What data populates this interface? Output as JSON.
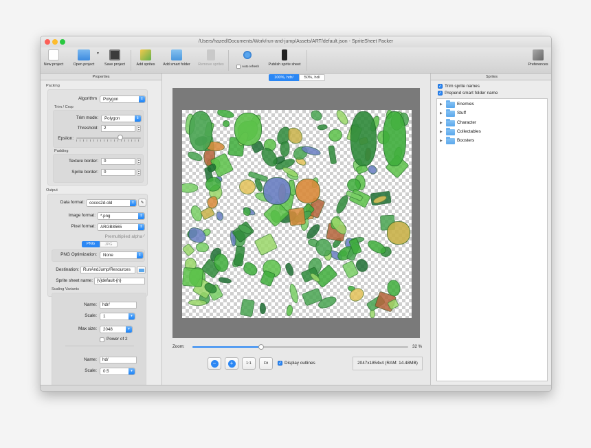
{
  "window": {
    "title": "/Users/hazed/Documents/Work/run-and-jump/Assets/ART/default.json - SpriteSheet Packer"
  },
  "toolbar": {
    "new_project": "New project",
    "open_project": "Open project",
    "save_project": "Save project",
    "add_sprites": "Add sprites",
    "add_smart_folder": "Add smart folder",
    "remove_sprites": "Remove sprites",
    "auto_refresh": "Auto refresh",
    "publish": "Publish sprite sheet",
    "preferences": "Preferences"
  },
  "properties": {
    "header": "Properties",
    "packing": {
      "title": "Packing",
      "algorithm_label": "Algorithm",
      "algorithm_value": "Polygon",
      "trim_title": "Trim / Crop",
      "trim_mode_label": "Trim mode:",
      "trim_mode_value": "Polygon",
      "threshold_label": "Threshold:",
      "threshold_value": "2",
      "epsilon_label": "Epsilon:",
      "epsilon_level": 0.68,
      "padding_title": "Padding",
      "texture_border_label": "Texture border:",
      "texture_border_value": "0",
      "sprite_border_label": "Sprite border:",
      "sprite_border_value": "0"
    },
    "output": {
      "title": "Output",
      "data_format_label": "Data format:",
      "data_format_value": "cocos2d-old",
      "image_format_label": "Image format:",
      "image_format_value": "*.png",
      "pixel_format_label": "Pixel format:",
      "pixel_format_value": "ARGB8565",
      "premultiplied": "Premultiplied alpha",
      "seg_png": "PNG",
      "seg_jpg": "JPG",
      "png_opt_label": "PNG Optimization:",
      "png_opt_value": "None",
      "destination_label": "Destination:",
      "destination_value": "RunAndJump/Resources",
      "sheet_name_label": "Sprite sheet name:",
      "sheet_name_value": "{v}default-{n}"
    },
    "scaling": {
      "title": "Scaling Variants",
      "name_label": "Name:",
      "name_value": "hdr/",
      "scale_label": "Scale:",
      "scale_value": "1",
      "max_size_label": "Max size:",
      "max_size_value": "2048",
      "power_of_2": "Power of 2",
      "name2_value": "hd/",
      "scale2_value": "0.5"
    }
  },
  "center": {
    "tabs": [
      "100%, hdr/",
      "50%, hd/"
    ],
    "zoom_label": "Zoom:",
    "zoom_value": "32 %",
    "zoom_level": 0.32,
    "btn_1to1": "1:1",
    "btn_fit": "Fit",
    "display_outlines": "Display outlines",
    "info": "2047x1854x4 (RAM: 14.48MB)"
  },
  "sprites": {
    "header": "Sprites",
    "trim_names": "Trim sprite names",
    "prepend_folder": "Prepend smart folder name",
    "folders": [
      "Enemies",
      "Stuff",
      "Character",
      "Collectables",
      "Boosters"
    ]
  },
  "colors": {
    "accent": "#2b87f4",
    "sprite_green": "#3fae3c"
  }
}
